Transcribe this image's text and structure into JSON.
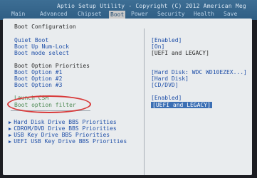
{
  "window": {
    "title": "Aptio Setup Utility - Copyright (C) 2012 American Meg"
  },
  "tabs": [
    {
      "label": "Main"
    },
    {
      "label": "Advanced"
    },
    {
      "label": "Chipset"
    },
    {
      "label": "Boot"
    },
    {
      "label": "Power"
    },
    {
      "label": "Security"
    },
    {
      "label": "Health"
    },
    {
      "label": "Save"
    }
  ],
  "boot": {
    "section_title": "Boot Configuration",
    "settings": [
      {
        "label": "Quiet Boot",
        "value": "[Enabled]"
      },
      {
        "label": "Boot Up Num-Lock",
        "value": "[On]"
      },
      {
        "label": "Boot mode select",
        "value": "[UEFI and LEGACY]"
      }
    ],
    "priorities_title": "Boot Option Priorities",
    "options": [
      {
        "label": "Boot Option #1",
        "value": "[Hard Disk: WDC WD10EZEX...]"
      },
      {
        "label": "Boot Option #2",
        "value": "[Hard Disk]"
      },
      {
        "label": "Boot Option #3",
        "value": "[CD/DVD]"
      }
    ],
    "launch_csm": {
      "label": "Launch CSM",
      "value": "[Enabled]"
    },
    "option_filter": {
      "label": "Boot option filter",
      "value": "[UEFI and LEGACY]"
    },
    "submenus": [
      {
        "label": "Hard Disk Drive BBS Priorities"
      },
      {
        "label": "CDROM/DVD Drive BBS Priorities"
      },
      {
        "label": "USB Key Drive BBS Priorities"
      },
      {
        "label": "UEFI USB Key Drive BBS Priorities"
      }
    ]
  }
}
